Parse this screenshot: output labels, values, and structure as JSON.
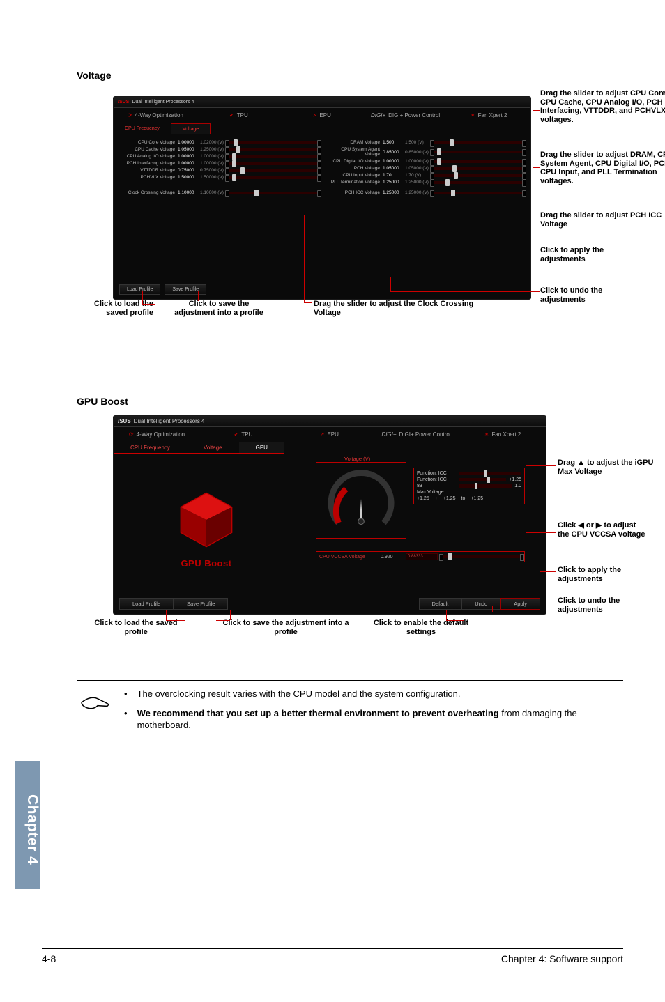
{
  "headings": {
    "voltage": "Voltage",
    "gpu_boost": "GPU Boost"
  },
  "app": {
    "title": "Dual Intelligent Processors 4",
    "tabs": {
      "opt": "4-Way Optimization",
      "tpu": "TPU",
      "epu": "EPU",
      "dpc": "DIGI+ Power Control",
      "fan": "Fan Xpert 2"
    },
    "subtabs": {
      "freq": "CPU Frequency",
      "voltage": "Voltage",
      "gpu": "GPU"
    },
    "rows_left": [
      {
        "label": "CPU Core Voltage",
        "val": "1.00000",
        "rng": "1.02000 (V)",
        "thumb": 8
      },
      {
        "label": "CPU Cache Voltage",
        "val": "1.05000",
        "rng": "1.25000 (V)",
        "thumb": 12
      },
      {
        "label": "CPU Analog I/O Voltage",
        "val": "1.00000",
        "rng": "1.00000 (V)",
        "thumb": 6
      },
      {
        "label": "PCH Interfacing Voltage",
        "val": "1.00000",
        "rng": "1.00000 (V)",
        "thumb": 6
      },
      {
        "label": "VTTDDR Voltage",
        "val": "0.75000",
        "rng": "0.75000 (V)",
        "thumb": 18
      },
      {
        "label": "PCHVLX Voltage",
        "val": "1.50000",
        "rng": "1.50000 (V)",
        "thumb": 6
      }
    ],
    "rows_right": [
      {
        "label": "DRAM Voltage",
        "val": "1.500",
        "rng": "1.500 (V)",
        "thumb": 24
      },
      {
        "label": "CPU System Agent Voltage",
        "val": "0.85000",
        "rng": "0.85000 (V)",
        "thumb": 6
      },
      {
        "label": "CPU Digital I/O Voltage",
        "val": "1.00000",
        "rng": "1.00000 (V)",
        "thumb": 6
      },
      {
        "label": "PCH Voltage",
        "val": "1.05000",
        "rng": "1.05000 (V)",
        "thumb": 28
      },
      {
        "label": "CPU Input Voltage",
        "val": "1.70",
        "rng": "1.70 (V)",
        "thumb": 30
      },
      {
        "label": "PLL Termination Voltage",
        "val": "1.25000",
        "rng": "1.25000 (V)",
        "thumb": 18
      }
    ],
    "cc_left": {
      "label": "Clock Crossing Voltage",
      "val": "1.10000",
      "rng": "1.10000 (V)",
      "thumb": 38
    },
    "cc_right": {
      "label": "PCH ICC Voltage",
      "val": "1.25000",
      "rng": "1.25000 (V)",
      "thumb": 26
    },
    "buttons": {
      "load": "Load Profile",
      "save": "Save Profile"
    }
  },
  "ann1": {
    "a": "Drag the slider to adjust CPU Core, CPU Cache, CPU Analog I/O, PCH Interfacing, VTTDDR, and PCHVLX voltages.",
    "b": "Drag the slider to adjust DRAM, CPU System Agent, CPU Digital I/O, PCH, CPU Input, and PLL Termination voltages.",
    "c": "Drag the slider to adjust PCH ICC Voltage",
    "d": "Click to apply the adjustments",
    "e": "Click to undo the adjustments",
    "load": "Click to load the saved profile",
    "save": "Click to save the adjustment into a profile",
    "cc": "Drag the slider to adjust the Clock Crossing Voltage"
  },
  "gpu": {
    "title2": "Dual Intelligent Processors 4",
    "boost_label": "GPU Boost",
    "dial_label": "Voltage (V)",
    "readouts": {
      "r1": "Function: ICC",
      "r2": "Function: ICC",
      "r3_a": "83",
      "r3_b": "+1.25",
      "r3_c": "1.0",
      "max": "Max Voltage",
      "max_a": "+1.25",
      "max_b": "+1.25",
      "max_c": "+1.25",
      "plus": "+",
      "to": "to"
    },
    "vccsa": {
      "label": "CPU VCCSA Voltage",
      "val": "0.920",
      "box": "0.88333"
    },
    "buttons": {
      "load": "Load Profile",
      "save": "Save Profile",
      "def": "Default",
      "undo": "Undo",
      "apply": "Apply"
    }
  },
  "ann2": {
    "a": "Drag ▲ to adjust the iGPU Max Voltage",
    "b": "Click ◀ or ▶ to adjust the CPU VCCSA voltage",
    "c": "Click to apply the adjustments",
    "d": "Click to undo the adjustments",
    "load": "Click to load the saved profile",
    "save": "Click to save the adjustment into a profile",
    "def": "Click to enable the default settings"
  },
  "notes": {
    "n1": "The overclocking result varies with the CPU model and the system configuration.",
    "n2_bold": "We recommend that you set up a better thermal environment to prevent overheating",
    "n2_rest": "from damaging the motherboard."
  },
  "chapter_tab": "Chapter 4",
  "footer": {
    "left": "4-8",
    "right": "Chapter 4: Software support"
  }
}
